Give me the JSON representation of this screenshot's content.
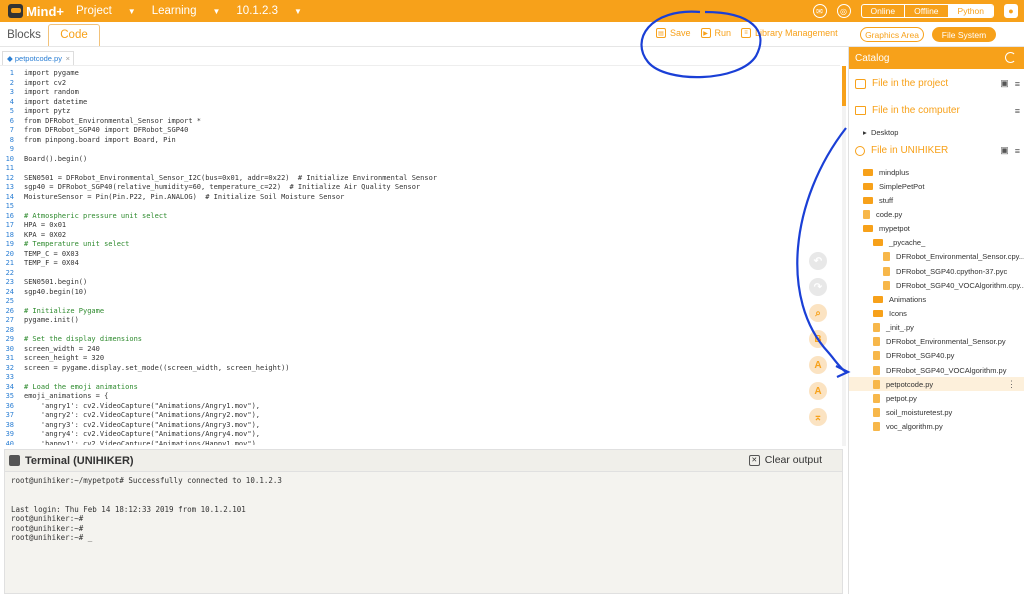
{
  "app": {
    "logo": "Mind+",
    "menu": [
      {
        "label": "Project"
      },
      {
        "label": "Learning"
      },
      {
        "label": "10.1.2.3"
      }
    ],
    "modes": {
      "online": "Online",
      "offline": "Offline",
      "python": "Python"
    }
  },
  "toolbar": {
    "blocks": "Blocks",
    "code": "Code",
    "save": "Save",
    "run": "Run",
    "library": "Library Management",
    "graphics": "Graphics Area",
    "filesystem": "File System"
  },
  "editor": {
    "file_tab": "petpotcode.py",
    "lines": [
      "import pygame",
      "import cv2",
      "import random",
      "import datetime",
      "import pytz",
      "from DFRobot_Environmental_Sensor import *",
      "from DFRobot_SGP40 import DFRobot_SGP40",
      "from pinpong.board import Board, Pin",
      "",
      "Board().begin()",
      "",
      "SEN0501 = DFRobot_Environmental_Sensor_I2C(bus=0x01, addr=0x22)  # Initialize Environmental Sensor",
      "sgp40 = DFRobot_SGP40(relative_humidity=60, temperature_c=22)  # Initialize Air Quality Sensor",
      "MoistureSensor = Pin(Pin.P22, Pin.ANALOG)  # Initialize Soil Moisture Sensor",
      "",
      "# Atmospheric pressure unit select",
      "HPA = 0x01",
      "KPA = 0X02",
      "# Temperature unit select",
      "TEMP_C = 0X03",
      "TEMP_F = 0X04",
      "",
      "SEN0501.begin()",
      "sgp40.begin(10)",
      "",
      "# Initialize Pygame",
      "pygame.init()",
      "",
      "# Set the display dimensions",
      "screen_width = 240",
      "screen_height = 320",
      "screen = pygame.display.set_mode((screen_width, screen_height))",
      "",
      "# Load the emoji animations",
      "emoji_animations = {",
      "    'angry1': cv2.VideoCapture(\"Animations/Angry1.mov\"),",
      "    'angry2': cv2.VideoCapture(\"Animations/Angry2.mov\"),",
      "    'angry3': cv2.VideoCapture(\"Animations/Angry3.mov\"),",
      "    'angry4': cv2.VideoCapture(\"Animations/Angry4.mov\"),",
      "    'happy1': cv2.VideoCapture(\"Animations/Happy1.mov\"),"
    ]
  },
  "terminal": {
    "title": "Terminal (UNIHIKER)",
    "clear": "Clear output",
    "lines": [
      "root@unihiker:~/mypetpot# Successfully connected to 10.1.2.3",
      "",
      "",
      "Last login: Thu Feb 14 18:12:33 2019 from 10.1.2.101",
      "root@unihiker:~#",
      "root@unihiker:~#",
      "root@unihiker:~# _"
    ]
  },
  "catalog": {
    "title": "Catalog",
    "sections": {
      "project": "File in the project",
      "computer": "File in the computer",
      "desktop": "Desktop",
      "unihiker": "File in UNIHIKER"
    },
    "tree": [
      {
        "name": "mindplus",
        "type": "folder",
        "depth": 0
      },
      {
        "name": "SimplePetPot",
        "type": "folder",
        "depth": 0
      },
      {
        "name": "stuff",
        "type": "folder",
        "depth": 0
      },
      {
        "name": "code.py",
        "type": "file",
        "depth": 0
      },
      {
        "name": "mypetpot",
        "type": "folder",
        "depth": 0
      },
      {
        "name": "_pycache_",
        "type": "folder",
        "depth": 1
      },
      {
        "name": "DFRobot_Environmental_Sensor.cpy...",
        "type": "file",
        "depth": 2
      },
      {
        "name": "DFRobot_SGP40.cpython-37.pyc",
        "type": "file",
        "depth": 2
      },
      {
        "name": "DFRobot_SGP40_VOCAlgorithm.cpy...",
        "type": "file",
        "depth": 2
      },
      {
        "name": "Animations",
        "type": "folder",
        "depth": 1
      },
      {
        "name": "Icons",
        "type": "folder",
        "depth": 1
      },
      {
        "name": "_init_.py",
        "type": "file",
        "depth": 1
      },
      {
        "name": "DFRobot_Environmental_Sensor.py",
        "type": "file",
        "depth": 1
      },
      {
        "name": "DFRobot_SGP40.py",
        "type": "file",
        "depth": 1
      },
      {
        "name": "DFRobot_SGP40_VOCAlgorithm.py",
        "type": "file",
        "depth": 1
      },
      {
        "name": "petpotcode.py",
        "type": "file",
        "depth": 1,
        "selected": true
      },
      {
        "name": "petpot.py",
        "type": "file",
        "depth": 1
      },
      {
        "name": "soil_moisturetest.py",
        "type": "file",
        "depth": 1
      },
      {
        "name": "voc_algorithm.py",
        "type": "file",
        "depth": 1
      }
    ]
  },
  "colors": {
    "accent": "#f7a11a",
    "annotation": "#1a3fd6"
  }
}
